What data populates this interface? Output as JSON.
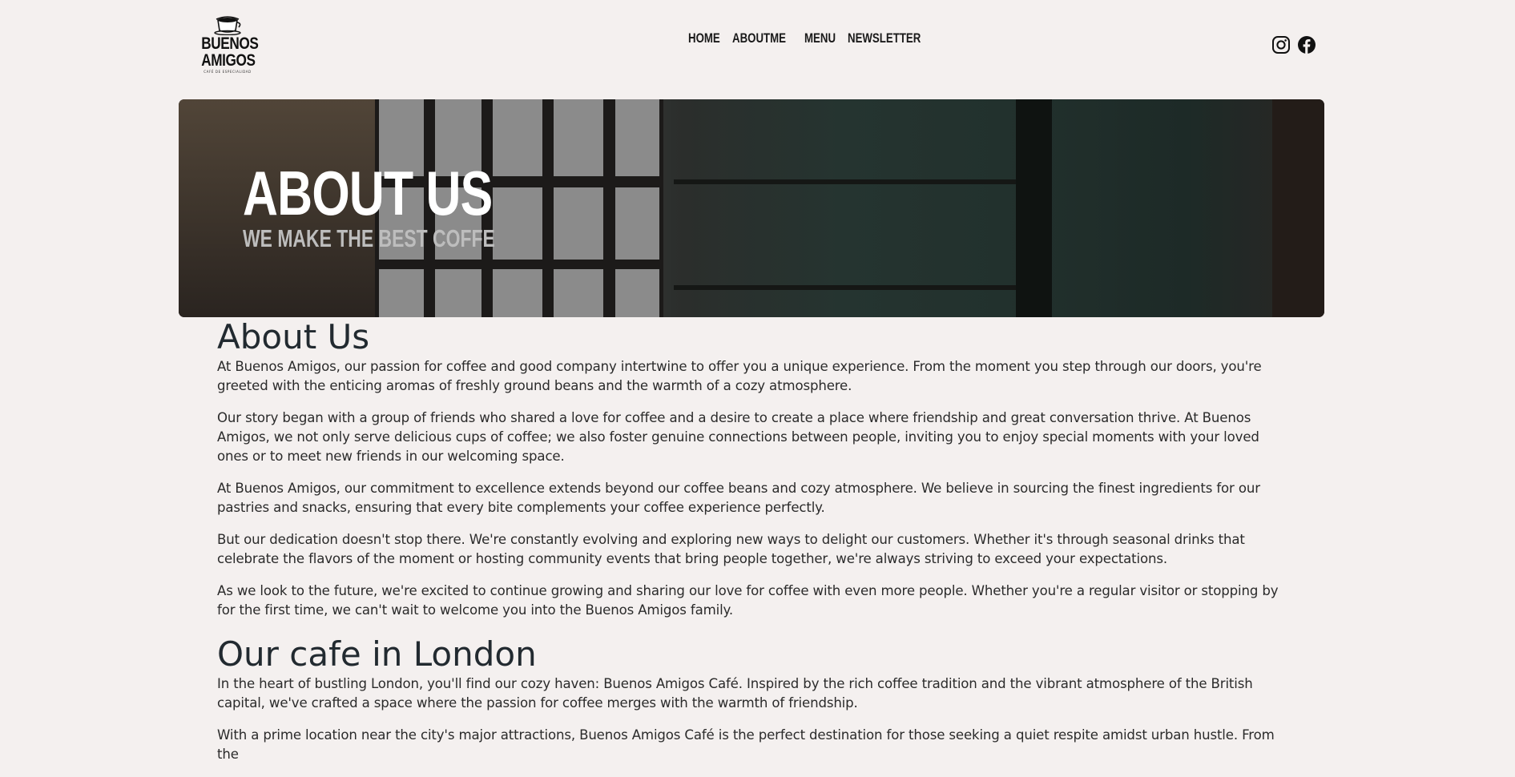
{
  "header": {
    "logo": {
      "line1": "BUENOS",
      "line2": "AMIGOS",
      "tagline": "CAFÉ DE ESPECIALIDAD"
    },
    "nav": [
      {
        "label": "HOME"
      },
      {
        "label": "ABOUTME"
      },
      {
        "label": "MENU"
      },
      {
        "label": "NEWSLETTER"
      }
    ],
    "social": [
      {
        "icon": "instagram-icon"
      },
      {
        "icon": "facebook-icon"
      }
    ]
  },
  "hero": {
    "title": "ABOUT US",
    "subtitle": "WE MAKE THE BEST COFFE"
  },
  "about": {
    "heading": "About Us",
    "paragraphs": [
      "At Buenos Amigos, our passion for coffee and good company intertwine to offer you a unique experience. From the moment you step through our doors, you're greeted with the enticing aromas of freshly ground beans and the warmth of a cozy atmosphere.",
      "Our story began with a group of friends who shared a love for coffee and a desire to create a place where friendship and great conversation thrive. At Buenos Amigos, we not only serve delicious cups of coffee; we also foster genuine connections between people, inviting you to enjoy special moments with your loved ones or to meet new friends in our welcoming space.",
      "At Buenos Amigos, our commitment to excellence extends beyond our coffee beans and cozy atmosphere. We believe in sourcing the finest ingredients for our pastries and snacks, ensuring that every bite complements your coffee experience perfectly.",
      "But our dedication doesn't stop there. We're constantly evolving and exploring new ways to delight our customers. Whether it's through seasonal drinks that celebrate the flavors of the moment or hosting community events that bring people together, we're always striving to exceed your expectations.",
      "As we look to the future, we're excited to continue growing and sharing our love for coffee with even more people. Whether you're a regular visitor or stopping by for the first time, we can't wait to welcome you into the Buenos Amigos family."
    ]
  },
  "london": {
    "heading": "Our cafe in London",
    "paragraphs": [
      "In the heart of bustling London, you'll find our cozy haven: Buenos Amigos Café. Inspired by the rich coffee tradition and the vibrant atmosphere of the British capital, we've crafted a space where the passion for coffee merges with the warmth of friendship.",
      "With a prime location near the city's major attractions, Buenos Amigos Café is the perfect destination for those seeking a quiet respite amidst urban hustle. From the"
    ]
  }
}
